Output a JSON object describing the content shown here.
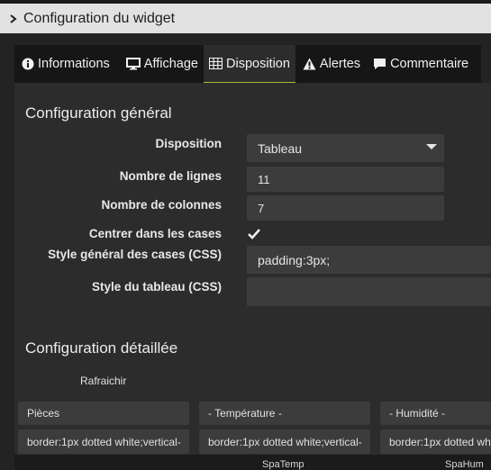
{
  "header": {
    "title": "Configuration du widget",
    "icon": "chevron-right-icon"
  },
  "tabs": [
    {
      "label": "Informations",
      "icon": "info-circle-icon"
    },
    {
      "label": "Affichage",
      "icon": "monitor-icon"
    },
    {
      "label": "Disposition",
      "icon": "table-icon",
      "active": true
    },
    {
      "label": "Alertes",
      "icon": "warning-icon"
    },
    {
      "label": "Commentaire",
      "icon": "comment-icon"
    }
  ],
  "general": {
    "title": "Configuration général",
    "disposition_label": "Disposition",
    "disposition_value": "Tableau",
    "rows_label": "Nombre de lignes",
    "rows_value": "11",
    "cols_label": "Nombre de colonnes",
    "cols_value": "7",
    "center_label": "Centrer dans les cases",
    "center_checked": true,
    "cell_style_label": "Style général des cases (CSS)",
    "cell_style_value": "padding:3px;",
    "table_style_label": "Style du tableau (CSS)",
    "table_style_value": ""
  },
  "detailed": {
    "title": "Configuration détaillée",
    "refresh_label": "Rafraichir",
    "row1": [
      "Pièces",
      "- Température -",
      "- Humidité -"
    ],
    "row2": [
      "border:1px dotted white;vertical-",
      "border:1px dotted white;vertical-",
      "border:1px dotted wh"
    ],
    "footer_cols": [
      "SpaTemp",
      "SpaHum"
    ]
  },
  "colors": {
    "accent": "#9bbf3a",
    "field_bg": "#3c3c3c",
    "panel_bg": "#2c2c2c"
  }
}
